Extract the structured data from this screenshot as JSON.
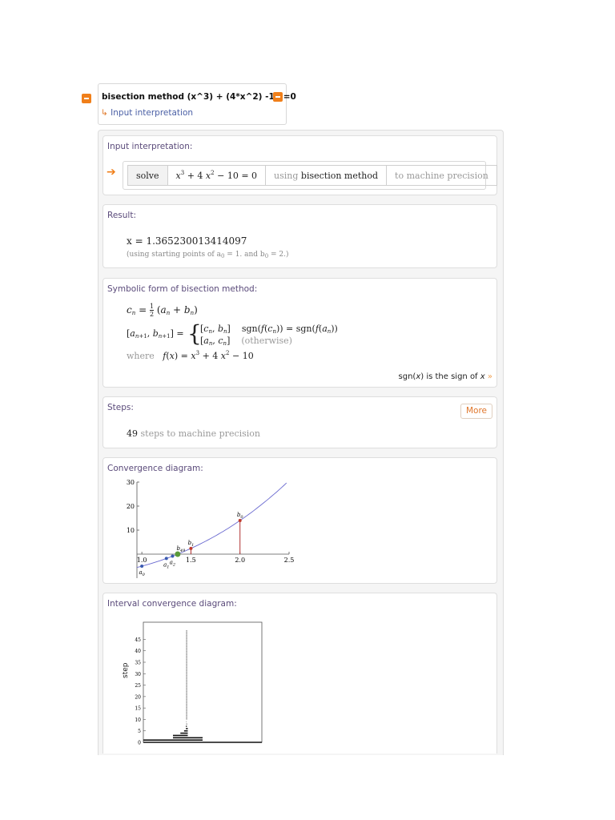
{
  "query": {
    "text": "bisection method (x^3) + (4*x^2) -10 =0",
    "interpretation_link": "Input interpretation"
  },
  "pods": {
    "input": {
      "title": "Input interpretation:",
      "solve": "solve",
      "equation": "x³ + 4 x² − 10 = 0",
      "using": "using",
      "method": "bisection method",
      "precision": "to machine precision"
    },
    "result": {
      "title": "Result:",
      "value": "x = 1.365230013414097",
      "note_prefix": "(using starting points of a",
      "note_a": " = 1. and b",
      "note_b": " = 2.)",
      "sub0": "0"
    },
    "symbolic": {
      "title": "Symbolic form of bisection method:",
      "where": "where",
      "fx": "f(x) = x³ + 4 x² − 10",
      "sgn_note_a": "sgn(",
      "sgn_note_x": "x",
      "sgn_note_b": ") is the sign of ",
      "sgn_note_c": "x",
      "otherwise": "(otherwise)"
    },
    "steps": {
      "title": "Steps:",
      "more": "More",
      "count": "49",
      "label": "steps to machine precision"
    },
    "convergence": {
      "title": "Convergence diagram:"
    },
    "interval": {
      "title": "Interval convergence diagram:",
      "ylabel": "step"
    }
  },
  "chart_data": [
    {
      "type": "line",
      "function": "x^3 + 4x^2 - 10",
      "x_ticks": [
        "1.0",
        "1.5",
        "2.0",
        "2.5"
      ],
      "y_ticks": [
        "10",
        "20",
        "30"
      ],
      "xlim": [
        0.95,
        2.5
      ],
      "ylim": [
        -10,
        30
      ],
      "points": [
        {
          "label": "a0",
          "x": 1.0,
          "y": -5,
          "color": "#3a5bb0"
        },
        {
          "label": "a1",
          "x": 1.25,
          "y": -1.8,
          "color": "#3a5bb0"
        },
        {
          "label": "a2",
          "x": 1.3125,
          "y": -0.85,
          "color": "#3a5bb0"
        },
        {
          "label": "b1",
          "x": 1.5,
          "y": 2.375,
          "color": "#c0392b"
        },
        {
          "label": "b0",
          "x": 2.0,
          "y": 14,
          "color": "#c0392b"
        },
        {
          "label": "b49",
          "x": 1.365,
          "y": 0,
          "color": "#5a9a3a"
        }
      ]
    },
    {
      "type": "bar",
      "orientation": "horizontal",
      "ylabel": "step",
      "y_ticks": [
        "0",
        "5",
        "10",
        "15",
        "20",
        "25",
        "30",
        "35",
        "40",
        "45"
      ],
      "xlim": [
        1.0,
        2.0
      ],
      "ylim": [
        0,
        49
      ],
      "intervals": [
        [
          1.0,
          2.0
        ],
        [
          1.0,
          1.5
        ],
        [
          1.25,
          1.5
        ],
        [
          1.25,
          1.375
        ],
        [
          1.3125,
          1.375
        ],
        [
          1.34375,
          1.375
        ],
        [
          1.359375,
          1.375
        ],
        [
          1.359375,
          1.3671875
        ],
        [
          1.36328125,
          1.3671875
        ],
        [
          1.36328125,
          1.365234375
        ]
      ],
      "converged_value": 1.365230013414097,
      "total_steps": 49
    }
  ]
}
